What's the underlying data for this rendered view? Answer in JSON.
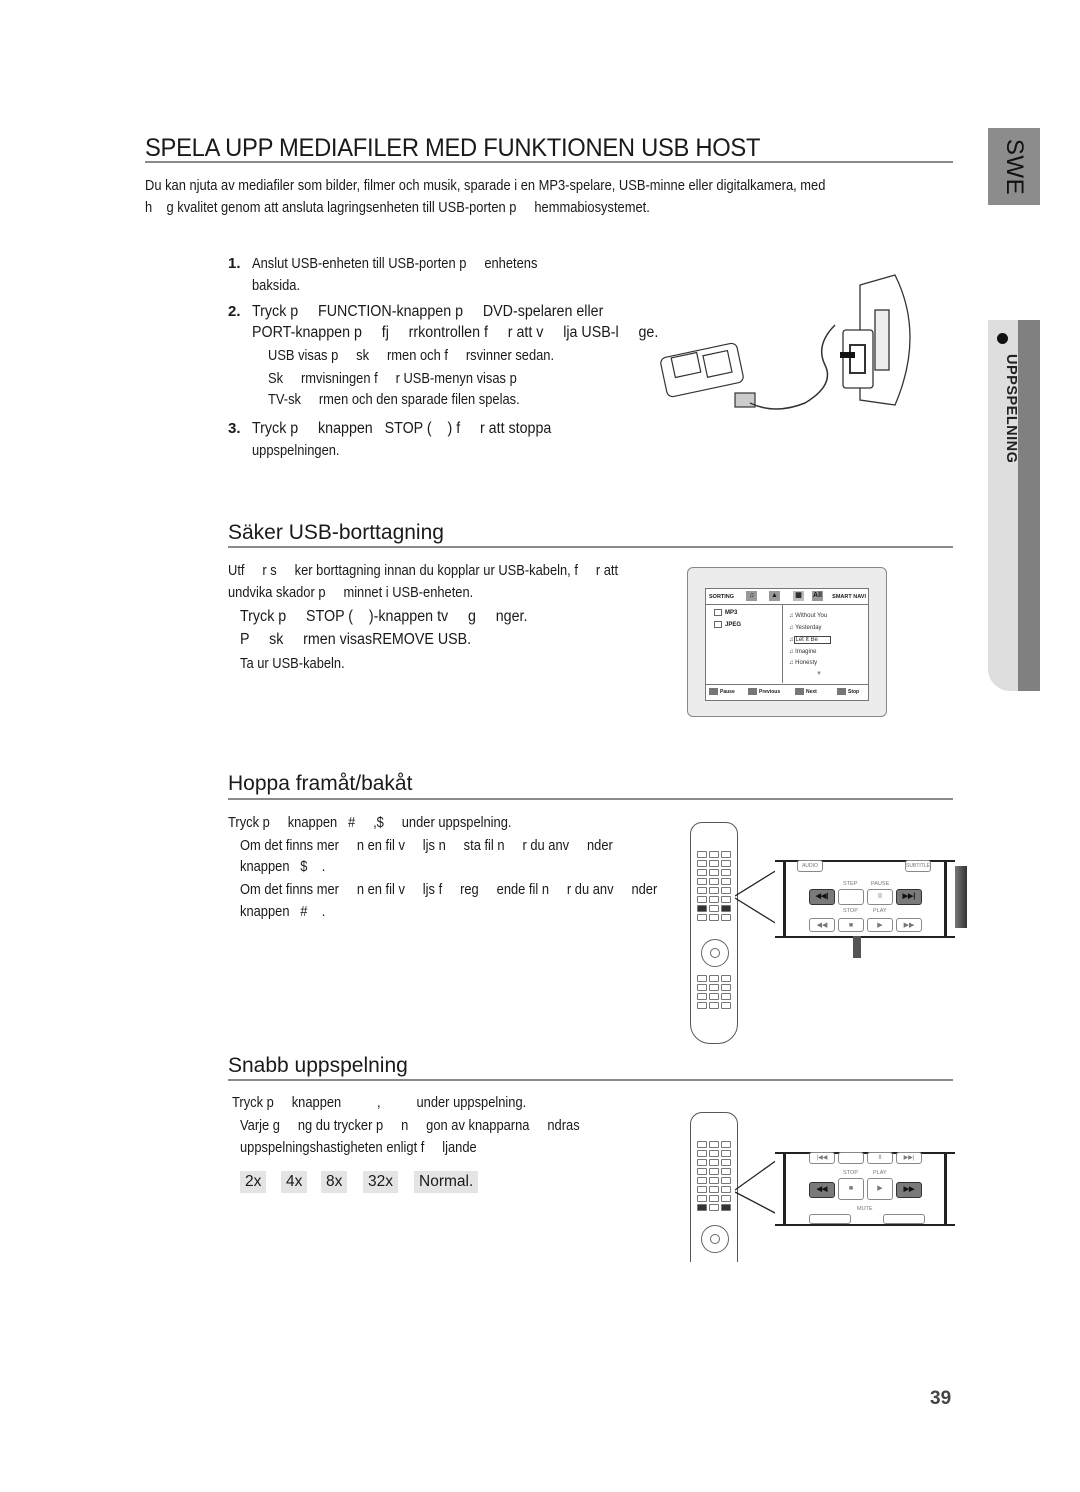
{
  "page": {
    "title": "SPELA UPP MEDIAFILER MED FUNKTIONEN USB HOST",
    "intro": [
      "Du kan njuta av mediafiler som bilder, filmer och musik, sparade i en MP3-spelare, USB-minne eller digitalkamera, med",
      "h    g kvalitet genom att ansluta lagringsenheten till USB-porten p     hemmabiosystemet."
    ],
    "page_number": "39"
  },
  "side_tabs": {
    "language": "SWE",
    "chapter": "UPPSPELNING"
  },
  "steps": [
    {
      "num": "1.",
      "lines": [
        "Anslut USB-enheten till USB-porten p     enhetens",
        "baksida."
      ]
    },
    {
      "num": "2.",
      "lines": [
        "Tryck p     FUNCTION-knappen p     DVD-spelaren eller",
        "PORT-knappen p     fj     rrkontrollen f     r att v     lja USB-l     ge."
      ],
      "notes": [
        "USB visas p     sk     rmen och f     rsvinner sedan.",
        "Sk     rmvisningen f     r USB-menyn visas p",
        "TV-sk     rmen och den sparade filen spelas."
      ]
    },
    {
      "num": "3.",
      "lines": [
        "Tryck p     knappen   STOP (    ) f     r att stoppa",
        "uppspelningen."
      ]
    }
  ],
  "sections": {
    "safe_removal": {
      "title": "Säker USB-borttagning",
      "body": [
        "Utf     r s     ker borttagning innan du kopplar ur USB-kabeln, f     r att",
        "undvika skador p     minnet i USB-enheten."
      ],
      "steps": [
        "Tryck p     STOP (    )-knappen tv     g     nger.",
        "P     sk     rmen visasREMOVE USB.",
        "Ta ur USB-kabeln."
      ]
    },
    "skip": {
      "title": "Hoppa framåt/bakåt",
      "body": "Tryck p     knappen   #     ,$     under uppspelning.",
      "notes": [
        "Om det finns mer     n en fil v     ljs n     sta fil n     r du anv     nder",
        "knappen   $    .",
        "Om det finns mer     n en fil v     ljs f     reg     ende fil n     r du anv     nder",
        "knappen   #    ."
      ]
    },
    "fast_play": {
      "title": "Snabb uppspelning",
      "body": "Tryck p     knappen          ,          under uppspelning.",
      "notes": [
        "Varje g     ng du trycker p     n     gon av knapparna     ndras",
        "uppspelningshastigheten enligt f     ljande"
      ],
      "speeds": [
        "2x",
        "4x",
        "8x",
        "32x",
        "Normal."
      ]
    }
  },
  "tv_screen": {
    "header": {
      "sorting": "SORTING",
      "all": "All",
      "smart_navi": "SMART NAVI"
    },
    "folders": [
      "MP3",
      "JPEG"
    ],
    "songs": [
      "Without You",
      "Yesterday",
      "Let It Be",
      "Imagine",
      "Honesty"
    ],
    "selected_song": "Let It Be",
    "footer": [
      "Pause",
      "Previous",
      "Next",
      "Stop"
    ]
  },
  "remote_skip": {
    "top_labels": [
      "AUDIO",
      "",
      "SUBTITLE"
    ],
    "mid_labels": [
      "STEP",
      "PAUSE"
    ],
    "bottom_labels": [
      "STOP",
      "PLAY"
    ],
    "buttons": [
      "skip-back",
      "step",
      "pause",
      "skip-forward"
    ],
    "glyphs": {
      "skip_back": "◀◀|",
      "pause": "II",
      "skip_fwd": "▶▶|",
      "rew": "◀◀",
      "stop": "■",
      "play": "▶",
      "ff": "▶▶"
    }
  },
  "remote_fast": {
    "mid_labels": [
      "STOP",
      "PLAY"
    ],
    "bottom_label": "MUTE",
    "glyphs": {
      "skip_back": "|◀◀",
      "pause": "II",
      "skip_fwd": "▶▶|",
      "rew": "◀◀",
      "stop": "■",
      "play": "▶",
      "ff": "▶▶"
    }
  }
}
